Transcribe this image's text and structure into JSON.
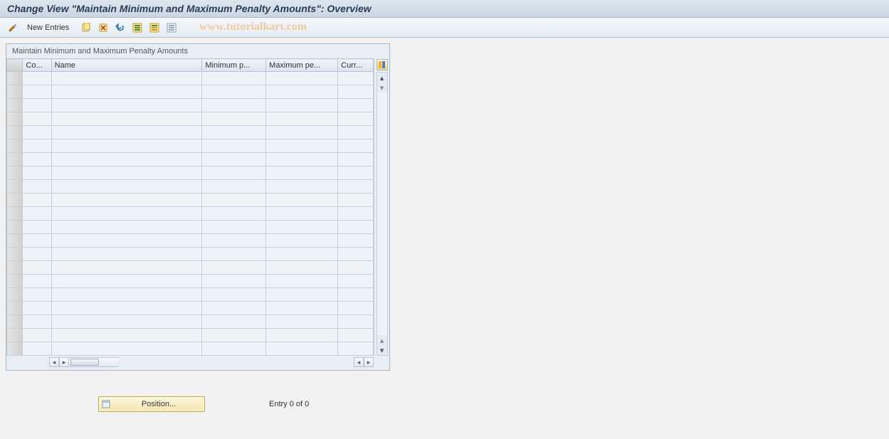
{
  "title": "Change View \"Maintain Minimum and Maximum Penalty Amounts\": Overview",
  "toolbar": {
    "new_entries": "New Entries"
  },
  "panel": {
    "title": "Maintain Minimum and Maximum Penalty Amounts",
    "columns": {
      "co": "Co...",
      "name": "Name",
      "min": "Minimum p...",
      "max": "Maximum pe...",
      "curr": "Curr..."
    },
    "row_count": 21
  },
  "footer": {
    "position_label": "Position...",
    "entry_text": "Entry 0 of 0"
  },
  "watermark": "www.tutorialkart.com"
}
